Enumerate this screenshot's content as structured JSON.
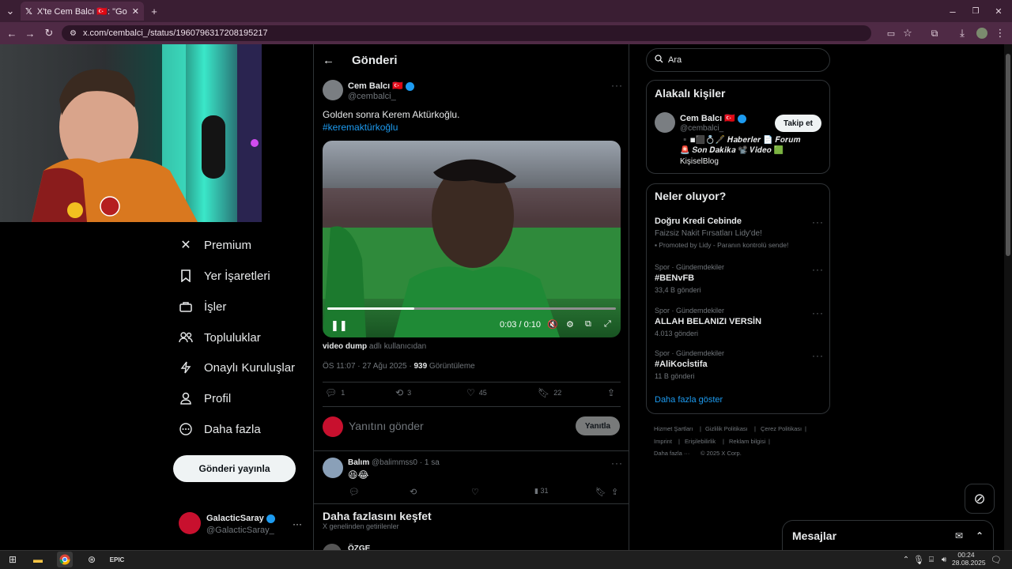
{
  "browser": {
    "tab_title": "X'te Cem Balcı 🇹🇷: \"Golden sonra",
    "url": "x.com/cembalci_/status/1960796317208195217"
  },
  "nav": {
    "premium": "Premium",
    "bookmarks": "Yer İşaretleri",
    "jobs": "İşler",
    "communities": "Topluluklar",
    "verified_orgs": "Onaylı Kuruluşlar",
    "profile": "Profil",
    "more": "Daha fazla",
    "post_button": "Gönderi yayınla",
    "account_name": "GalacticSaray",
    "account_handle": "@GalacticSaray_"
  },
  "header": {
    "title": "Gönderi"
  },
  "tweet": {
    "author_name": "Cem Balcı 🇹🇷",
    "author_handle": "@cembalci_",
    "text": "Golden sonra Kerem Aktürkoğlu.",
    "hashtag": "#keremaktürkoğlu",
    "video_time": "0:03 / 0:10",
    "video_progress": 0.3,
    "credit_user": "video dump",
    "credit_suffix": "adlı kullanıcıdan",
    "timestamp": "ÖS 11:07 · 27 Ağu 2025 ·",
    "views_count": "939",
    "views_label": "Görüntüleme",
    "replies": "1",
    "retweets": "3",
    "likes": "45",
    "bookmarks": "22"
  },
  "reply_box": {
    "placeholder": "Yanıtını gönder",
    "button": "Yanıtla"
  },
  "reply": {
    "name": "Balım",
    "handle": "@balimmss0",
    "time": "· 1 sa",
    "text": "😆😂",
    "views": "31"
  },
  "discover": {
    "title": "Daha fazlasını keşfet",
    "subtitle": "X genelinden getirilenler",
    "next_name": "ÖZGE"
  },
  "search": {
    "placeholder": "Ara"
  },
  "related": {
    "title": "Alakalı kişiler",
    "name": "Cem Balcı 🇹🇷",
    "handle": "@cembalci_",
    "follow": "Takip et",
    "bio_line1": "▪️◾⬛💍🖋️ 𝑯𝒂𝒃𝒆𝒓𝒍𝒆𝒓 📄 𝑭𝒐𝒓𝒖𝒎",
    "bio_line2": "🚨 𝑺𝒐𝒏 𝑫𝒂𝒌𝒊𝒌𝒂 📽️ 𝑽𝒊𝒅𝒆𝒐 🟩",
    "bio_line3": "KişiselBlog"
  },
  "trends": {
    "title": "Neler oluyor?",
    "items": [
      {
        "title": "Doğru Kredi Cebinde",
        "sub": "Faizsiz Nakit Fırsatları Lidy'de!",
        "promo": "Promoted by Lidy - Paranın kontrolü sende!"
      },
      {
        "category": "Spor · Gündemdekiler",
        "title": "#BENvFB",
        "count": "33,4 B gönderi"
      },
      {
        "category": "Spor · Gündemdekiler",
        "title": "ALLAH BELANIZI VERSİN",
        "count": "4.013 gönderi"
      },
      {
        "category": "Spor · Gündemdekiler",
        "title": "#AliKocİstifa",
        "count": "11 B gönderi"
      }
    ],
    "show_more": "Daha fazla göster"
  },
  "footer": {
    "terms": "Hizmet Şartları",
    "privacy": "Gizlilik Politikası",
    "cookies": "Çerez Politikası",
    "imprint": "Imprint",
    "accessibility": "Erişilebilirlik",
    "ads": "Reklam bilgisi",
    "more": "Daha fazla ···",
    "copyright": "© 2025 X Corp."
  },
  "messages": {
    "title": "Mesajlar"
  },
  "taskbar": {
    "time": "00:24",
    "date": "28.08.2025"
  },
  "colors": {
    "accent": "#1d9bf0",
    "chrome_tab": "#4f2a45",
    "chrome_bg": "#3a1e33"
  }
}
